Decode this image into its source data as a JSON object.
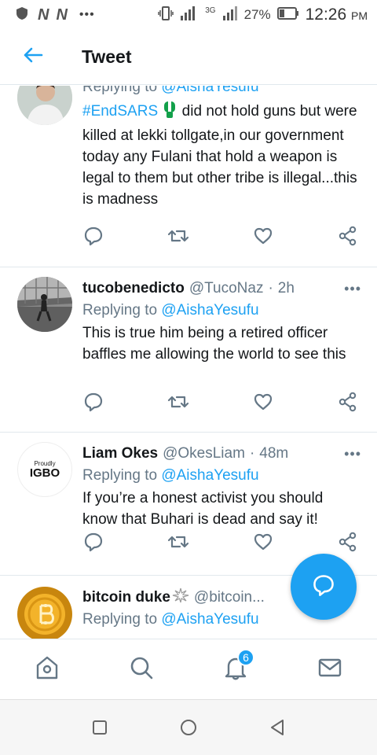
{
  "status_bar": {
    "battery_percent": "27%",
    "time": "12:26",
    "ampm": "PM",
    "network": "3G",
    "notification_logos": [
      "N",
      "N"
    ]
  },
  "header": {
    "title": "Tweet"
  },
  "colors": {
    "accent": "#1da1f2",
    "text": "#14171a",
    "secondary": "#657786",
    "divider": "#e1e8ed"
  },
  "tweets": [
    {
      "replying_prefix": "Replying to",
      "replying_to": "@AishaYesufu",
      "hashtag": "#EndSARS",
      "text": " did not hold guns but were killed at lekki tollgate,in our government today any Fulani that hold a weapon is legal to them but other tribe is illegal...this is madness"
    },
    {
      "name": "tucobenedicto",
      "handle": "@TucoNaz",
      "dot": "·",
      "ago": "2h",
      "replying_prefix": "Replying to",
      "replying_to": "@AishaYesufu",
      "text": "This is true him being a retired officer baffles me allowing the world to see this"
    },
    {
      "name": "Liam Okes",
      "handle": "@OkesLiam",
      "dot": "·",
      "ago": "48m",
      "avatar_text_top": "Proudly",
      "avatar_text": "IGBO",
      "replying_prefix": "Replying to",
      "replying_to": "@AishaYesufu",
      "text": "If you’re a honest activist you should know that Buhari is dead and say it!"
    },
    {
      "name": "bitcoin duke",
      "handle": "@bitcoin...",
      "replying_prefix": "Replying to",
      "replying_to": "@AishaYesufu"
    }
  ],
  "tabbar": {
    "notifications_badge": "6"
  },
  "icons": [
    "back-arrow-icon",
    "reply-icon",
    "retweet-icon",
    "like-icon",
    "share-icon",
    "more-icon",
    "home-icon",
    "search-icon",
    "bell-icon",
    "mail-icon",
    "compose-reply-icon"
  ]
}
